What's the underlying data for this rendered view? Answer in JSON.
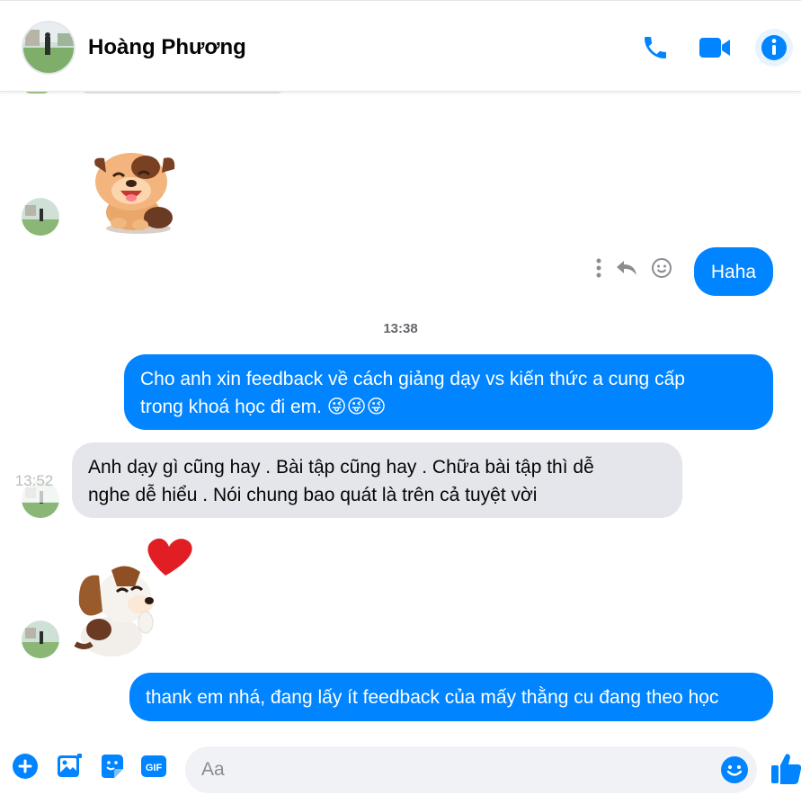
{
  "colors": {
    "accent": "#0084ff",
    "incoming_bubble": "#e4e6eb",
    "muted": "#65676b"
  },
  "header": {
    "contact_name": "Hoàng Phương",
    "icons": [
      "phone-icon",
      "video-camera-icon",
      "info-icon"
    ]
  },
  "conversation": {
    "outgoing_haha": "Haha",
    "timestamp": "13:38",
    "outgoing_feedback_line1": "Cho anh xin feedback về cách giảng dạy vs kiến thức a cung cấp",
    "outgoing_feedback_line2": "trong khoá học đi em. 😜😜😜",
    "incoming_hover_time": "13:52",
    "incoming_reply_line1": "Anh dạy gì cũng hay . Bài tập cũng hay . Chữa bài tập thì dễ",
    "incoming_reply_line2": "nghe dễ hiểu . Nói chung bao quát là trên cả tuyệt vời",
    "outgoing_thanks": "thank em nhá, đang lấy ít feedback của mấy thằng cu đang theo học",
    "stickers": [
      "puppy-laughing-sticker",
      "beagle-heart-sticker"
    ],
    "message_actions": [
      "more-icon",
      "reply-icon",
      "react-icon"
    ]
  },
  "composer": {
    "placeholder": "Aa",
    "icons": [
      "plus-icon",
      "photo-icon",
      "sticker-icon",
      "gif-icon",
      "emoji-icon",
      "like-icon"
    ],
    "gif_label": "GIF"
  }
}
